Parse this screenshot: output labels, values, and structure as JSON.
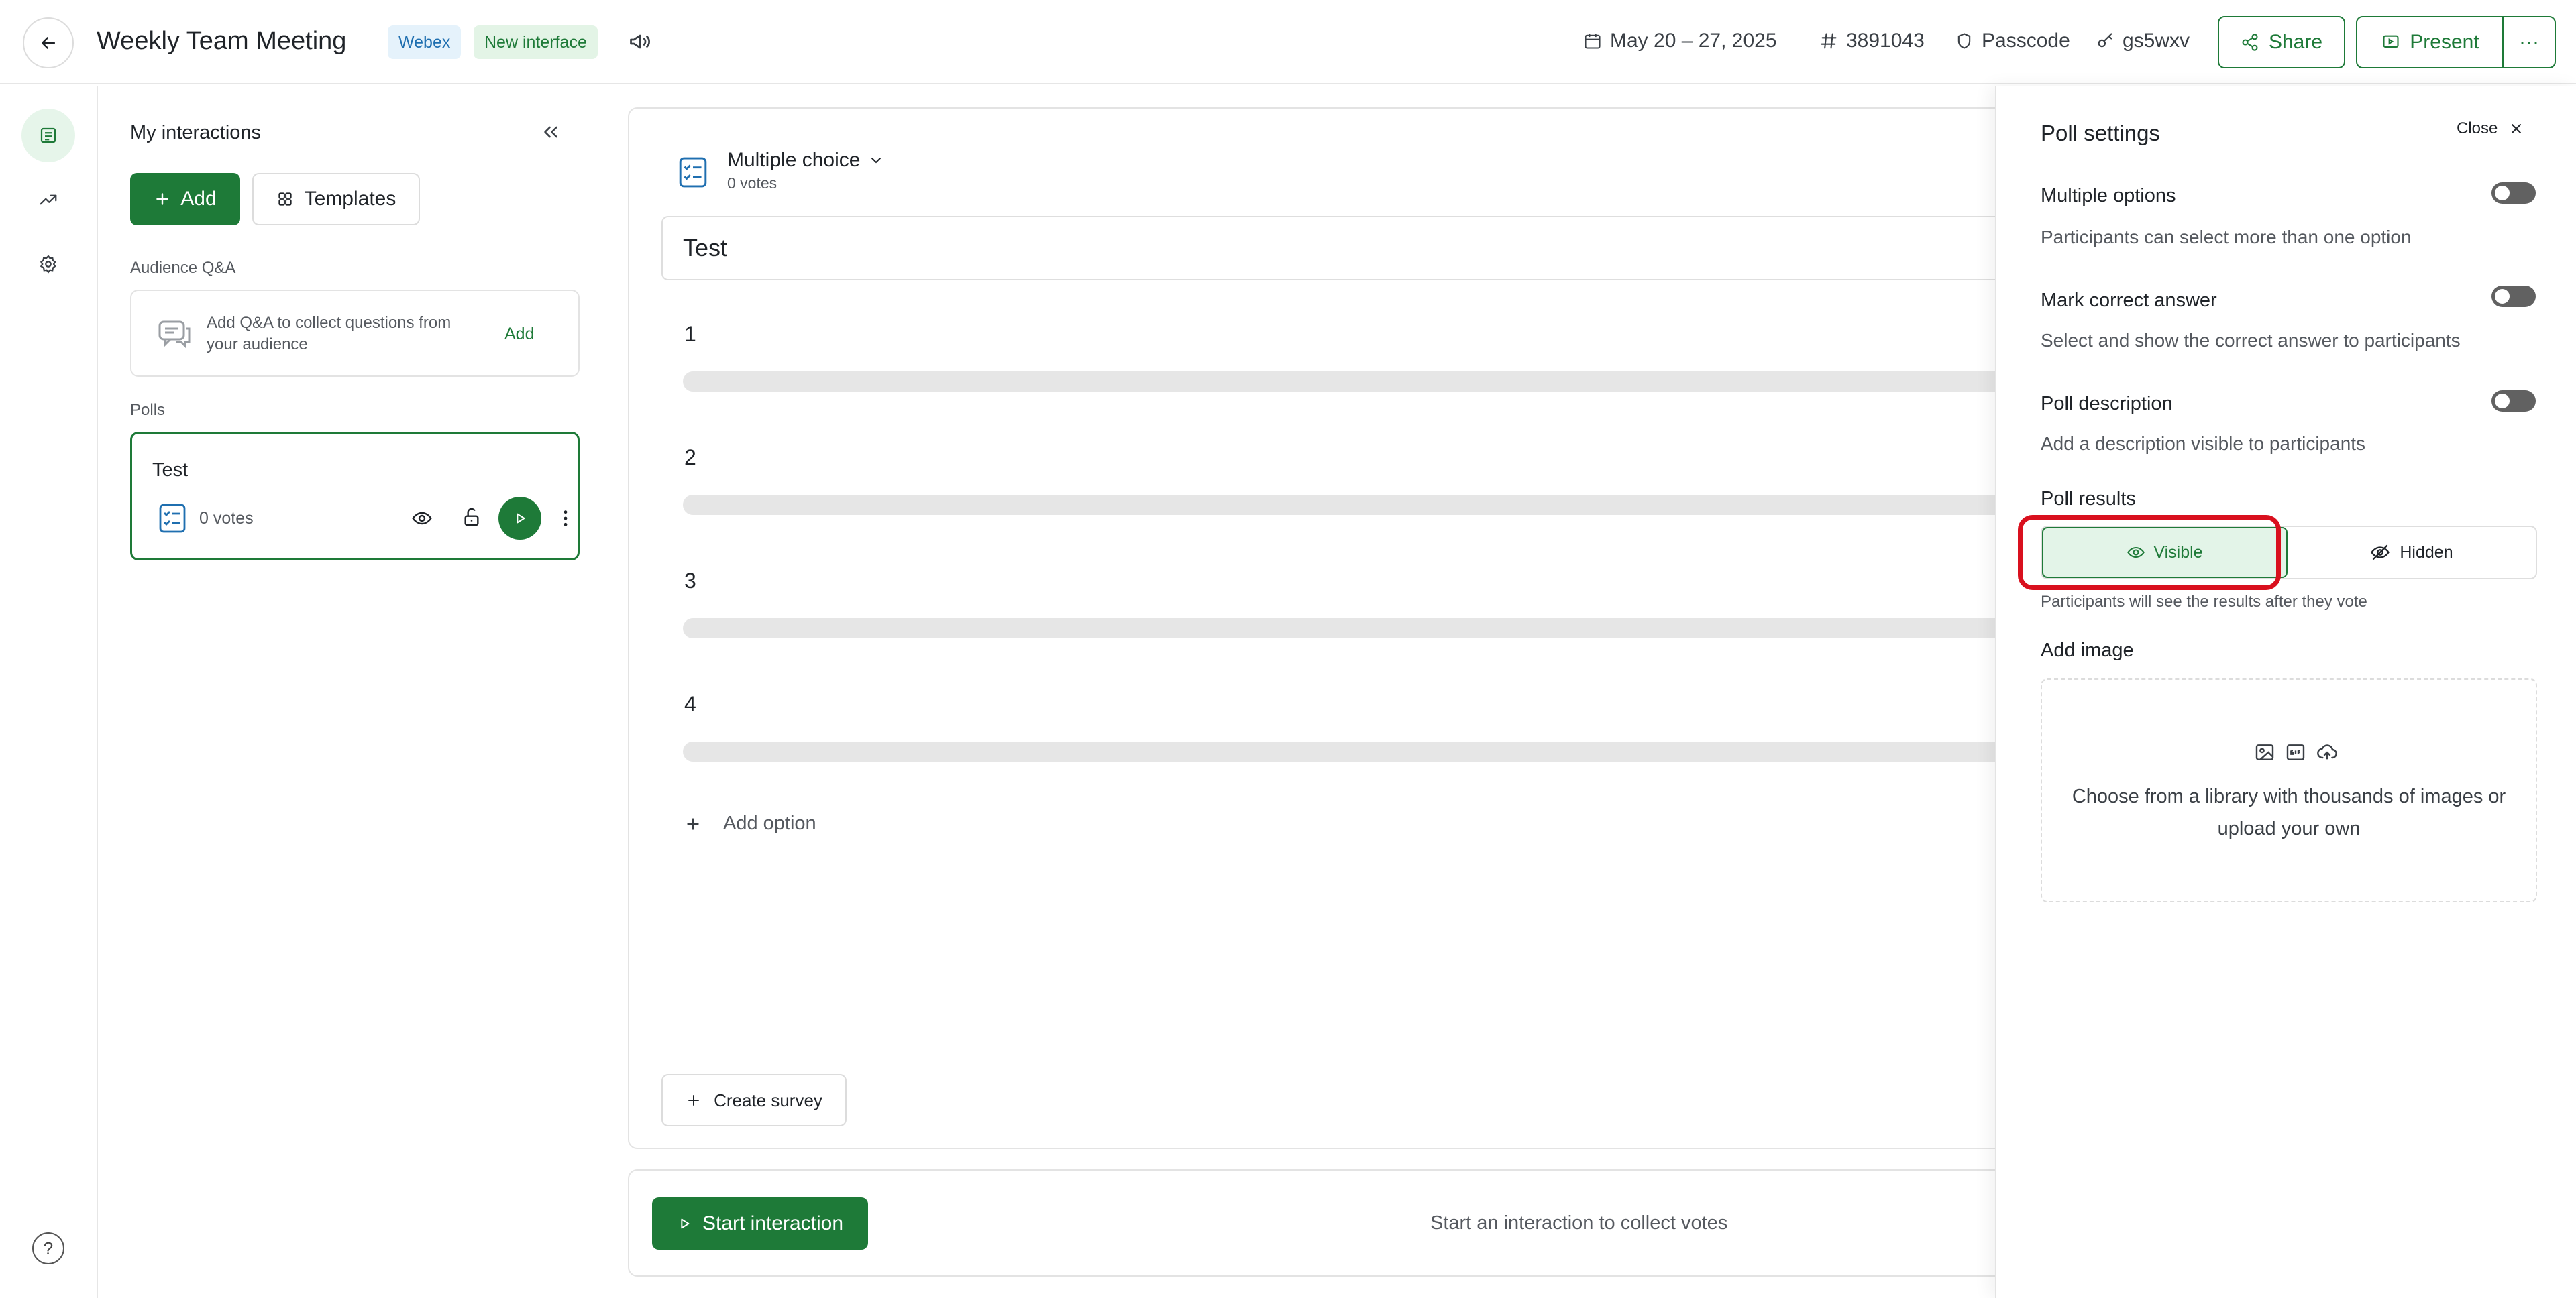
{
  "header": {
    "title": "Weekly Team Meeting",
    "badge_webex": "Webex",
    "badge_new": "New interface",
    "date": "May 20 – 27, 2025",
    "event_id": "3891043",
    "passcode_label": "Passcode",
    "passcode_value": "gs5wxv",
    "share_label": "Share",
    "present_label": "Present",
    "more_label": "···"
  },
  "panel": {
    "title": "My interactions",
    "add_label": "Add",
    "templates_label": "Templates",
    "qa_section": "Audience Q&A",
    "qa_text": "Add Q&A to collect questions from your audience",
    "qa_add": "Add",
    "polls_section": "Polls",
    "poll_title": "Test",
    "poll_votes": "0 votes"
  },
  "editor": {
    "type_label": "Multiple choice",
    "type_votes": "0 votes",
    "question": "Test",
    "options": [
      "1",
      "2",
      "3",
      "4"
    ],
    "add_option": "Add option",
    "create_survey": "Create survey",
    "start_label": "Start interaction",
    "footer_hint": "Start an interaction to collect votes"
  },
  "settings": {
    "title": "Poll settings",
    "close": "Close",
    "multiple_title": "Multiple options",
    "multiple_desc": "Participants can select more than one option",
    "correct_title": "Mark correct answer",
    "correct_desc": "Select and show the correct answer to participants",
    "description_title": "Poll description",
    "description_desc": "Add a description visible to participants",
    "results_title": "Poll results",
    "visible_label": "Visible",
    "hidden_label": "Hidden",
    "results_hint": "Participants will see the results after they vote",
    "image_title": "Add image",
    "image_text": "Choose from a library with thousands of images or upload your own",
    "toggles": {
      "multiple": false,
      "correct": false,
      "description": false
    },
    "selected_result_mode": "Visible"
  },
  "help_label": "?",
  "colors": {
    "accent": "#1e7a38",
    "highlight": "#d9101e"
  }
}
